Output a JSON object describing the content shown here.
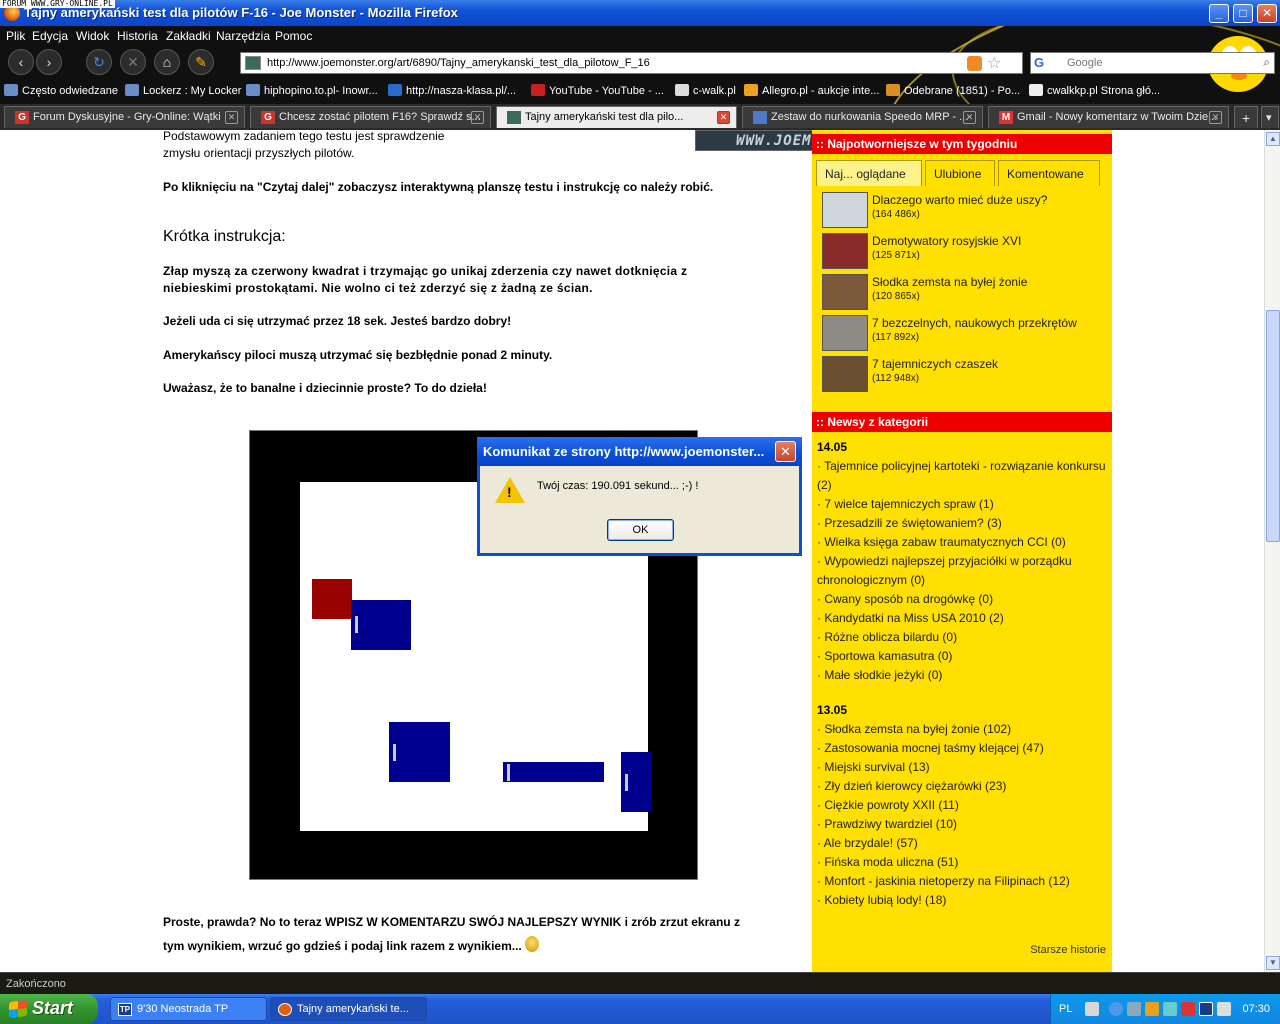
{
  "watermark": "FORUM WWW.GRY-ONLINE.PL",
  "window": {
    "title": "Tajny amerykański test dla pilotów F-16 - Joe Monster - Mozilla Firefox",
    "minimize": "_",
    "maximize": "□",
    "close": "✕"
  },
  "menu": [
    "Plik",
    "Edycja",
    "Widok",
    "Historia",
    "Zakładki",
    "Narzędzia",
    "Pomoc"
  ],
  "nav": {
    "url": "http://www.joemonster.org/art/6890/Tajny_amerykanski_test_dla_pilotow_F_16",
    "search_placeholder": "Google",
    "search_engine": "G"
  },
  "bookmarks": [
    "Często odwiedzane",
    "Lockerz : My Locker",
    "hiphopino.to.pl- Inowr...",
    "http://nasza-klasa.pl/...",
    "YouTube - YouTube - ...",
    "c-walk.pl",
    "Allegro.pl - aukcje inte...",
    "Odebrane (1851) - Po...",
    "cwalkkp.pl Strona głó..."
  ],
  "tabs": [
    {
      "icon": "G",
      "label": "Forum Dyskusyjne - Gry-Online: Wątki"
    },
    {
      "icon": "G",
      "label": "Chcesz zostać pilotem F16? Sprawdź s..."
    },
    {
      "icon": "",
      "label": "Tajny amerykański test dla pilo..."
    },
    {
      "icon": "",
      "label": "Zestaw do nurkowania Speedo MRP - ..."
    },
    {
      "icon": "M",
      "label": "Gmail - Nowy komentarz w Twoim Dzie..."
    }
  ],
  "new_tab": "+",
  "tab_list": "▾",
  "article": {
    "logo": "WWW.JOEMONSTER.ORG",
    "intro_line1": "Podstawowym zadaniem tego testu jest sprawdzenie",
    "intro_line2": "zmysłu orientacji przyszłych pilotów.",
    "click_info": "Po kliknięciu na \"Czytaj dalej\" zobaczysz interaktywną planszę testu i instrukcję co należy robić.",
    "heading": "Krótka instrukcja:",
    "instr1_line1": "Złap myszą za czerwony kwadrat i trzymając go unikaj zderzenia czy nawet dotknięcia z",
    "instr1_line2": "niebieskimi prostokątami. Nie wolno ci też zderzyć się z żadną ze ścian.",
    "instr2": "Jeżeli uda ci się utrzymać przez 18 sek. Jesteś bardzo dobry!",
    "instr3": "Amerykańscy piloci muszą utrzymać się bezbłędnie ponad 2 minuty.",
    "instr4": "Uważasz, że to banalne i dziecinnie proste? To do dzieła!",
    "outro_line1": "Proste, prawda? No to teraz WPISZ W KOMENTARZU SWÓJ NAJLEPSZY WYNIK i zrób zrzut ekranu z",
    "outro_line2": "tym wynikiem, wrzuć go gdzieś i podaj link razem z wynikiem..."
  },
  "sidebar": {
    "top_header": ":: Najpotworniejsze w tym tygodniu",
    "tabs": [
      "Naj... oglądane",
      "Ulubione",
      "Komentowane"
    ],
    "popular": [
      {
        "title": "Dlaczego warto mieć duże uszy?",
        "views": "(164 486x)",
        "thumb": "#cfd6dc"
      },
      {
        "title": "Demotywatory rosyjskie XVI",
        "views": "(125 871x)",
        "thumb": "#8a2a2a"
      },
      {
        "title": "Słodka zemsta na byłej żonie",
        "views": "(120 865x)",
        "thumb": "#7a5a3a"
      },
      {
        "title": "7 bezczelnych, naukowych przekrętów",
        "views": "(117 892x)",
        "thumb": "#8c8c84"
      },
      {
        "title": "7 tajemniczych czaszek",
        "views": "(112 948x)",
        "thumb": "#6a5030"
      }
    ],
    "news_header": ":: Newsy z kategorii",
    "news": [
      {
        "date": "14.05",
        "items": [
          "· Tajemnice policyjnej kartoteki - rozwiązanie konkursu (2)",
          "· 7 wielce tajemniczych spraw (1)",
          "· Przesadzili ze świętowaniem? (3)",
          "· Wielka księga zabaw traumatycznych CCI (0)",
          "· Wypowiedzi najlepszej przyjaciółki w porządku chronologicznym (0)",
          "· Cwany sposób na drogówkę (0)",
          "· Kandydatki na Miss USA 2010 (2)",
          "· Różne oblicza bilardu (0)",
          "· Sportowa kamasutra (0)",
          "· Małe słodkie jeżyki (0)"
        ]
      },
      {
        "date": "13.05",
        "items": [
          "· Słodka zemsta na byłej żonie (102)",
          "· Zastosowania mocnej taśmy klejącej (47)",
          "· Miejski survival (13)",
          "· Zły dzień kierowcy ciężarówki (23)",
          "· Ciężkie powroty XXII (11)",
          "· Prawdziwy twardziel (10)",
          "· Ale brzydale! (57)",
          "· Fińska moda uliczna (51)",
          "· Monfort - jaskinia nietoperzy na Filipinach (12)",
          "· Kobiety lubią lody! (18)"
        ]
      }
    ],
    "older": "Starsze historie"
  },
  "dialog": {
    "title": "Komunikat ze strony http://www.joemonster...",
    "message": "Twój czas: 190.091 sekund... ;-) !",
    "ok": "OK",
    "close": "✕"
  },
  "status": "Zakończono",
  "taskbar": {
    "start": "Start",
    "tasks": [
      {
        "icon": "TP",
        "label": "9'30 Neostrada TP"
      },
      {
        "icon": "",
        "label": "Tajny amerykański te..."
      }
    ],
    "lang": "PL",
    "clock": "07:30"
  },
  "colors": {
    "sidebar_bg": "#ffe000",
    "sidebar_header": "#e00000",
    "game_blue": "#00008f",
    "game_red": "#990000"
  }
}
